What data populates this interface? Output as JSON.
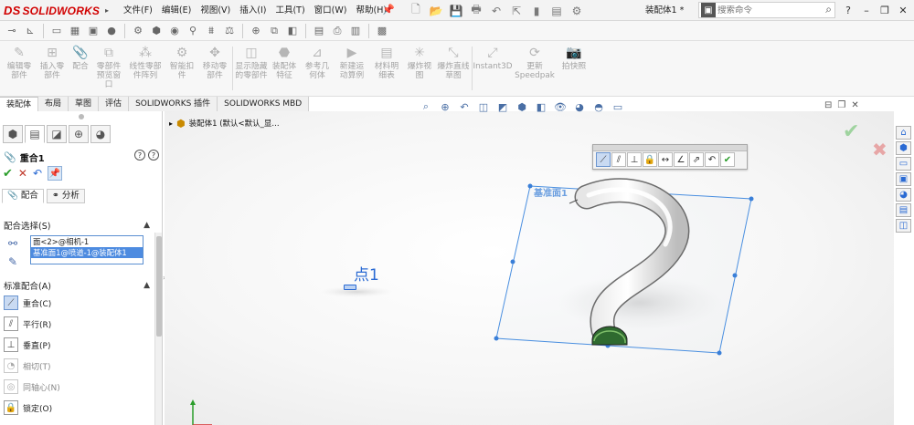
{
  "app": {
    "logo_text": "SOLIDWORKS",
    "logo_ds": "DS",
    "menus": [
      "文件(F)",
      "编辑(E)",
      "视图(V)",
      "插入(I)",
      "工具(T)",
      "窗口(W)",
      "帮助(H)"
    ],
    "doc_title": "装配体1 *",
    "search_placeholder": "搜索命令"
  },
  "ribbon": {
    "buttons": [
      "编辑零部件",
      "插入零部件",
      "配合",
      "零部件预览窗口",
      "线性零部件阵列",
      "智能扣件",
      "移动零部件",
      "显示隐藏的零部件",
      "装配体特征",
      "参考几何体",
      "新建运动算例",
      "材料明细表",
      "爆炸视图",
      "爆炸直线草图",
      "Instant3D",
      "更新Speedpak",
      "拍快照"
    ]
  },
  "tabs": [
    "装配体",
    "布局",
    "草图",
    "评估",
    "SOLIDWORKS 插件",
    "SOLIDWORKS MBD"
  ],
  "property_manager": {
    "title": "重合1",
    "subtabs": [
      "配合",
      "分析"
    ],
    "section_selections": "配合选择(S)",
    "selections": [
      "面<2>@相机-1",
      "基准面1@喷道-1@装配体1"
    ],
    "section_standard": "标准配合(A)",
    "mates": [
      {
        "label": "重合(C)",
        "icon": "coincident-icon",
        "selected": true,
        "enabled": true
      },
      {
        "label": "平行(R)",
        "icon": "parallel-icon",
        "selected": false,
        "enabled": true
      },
      {
        "label": "垂直(P)",
        "icon": "perpendicular-icon",
        "selected": false,
        "enabled": true
      },
      {
        "label": "相切(T)",
        "icon": "tangent-icon",
        "selected": false,
        "enabled": false
      },
      {
        "label": "同轴心(N)",
        "icon": "concentric-icon",
        "selected": false,
        "enabled": false
      },
      {
        "label": "锁定(O)",
        "icon": "lock-icon",
        "selected": false,
        "enabled": true
      }
    ]
  },
  "graphics": {
    "tree_node": "装配体1  (默认<默认_显...",
    "plane_label": "基准面1",
    "point_label": "点1"
  },
  "colors": {
    "accent": "#2a6ad3",
    "plane_edge": "#4a8fe0",
    "logo_red": "#d10000"
  }
}
